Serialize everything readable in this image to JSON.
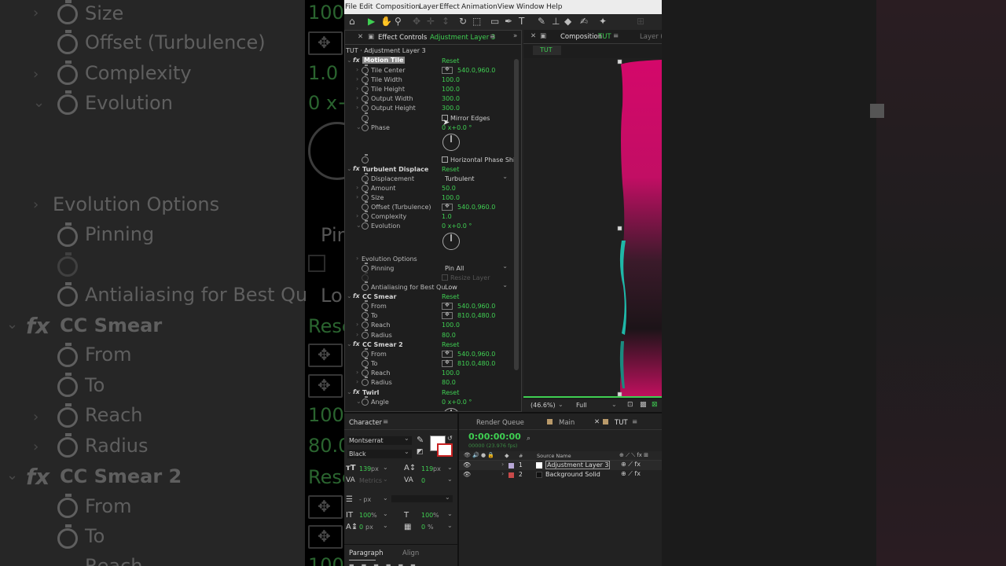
{
  "menu": [
    "File",
    "Edit",
    "Composition",
    "Layer",
    "Effect",
    "Animation",
    "View",
    "Window",
    "Help"
  ],
  "effect_panel": {
    "tab_label": "Effect Controls",
    "tab_layer": "Adjustment Layer 3",
    "breadcrumb": "TUT · Adjustment Layer 3",
    "reset": "Reset",
    "motion_tile": {
      "name": "Motion Tile",
      "tile_center": {
        "label": "Tile Center",
        "value": "540.0,960.0"
      },
      "tile_width": {
        "label": "Tile Width",
        "value": "100.0"
      },
      "tile_height": {
        "label": "Tile Height",
        "value": "100.0"
      },
      "output_width": {
        "label": "Output Width",
        "value": "300.0"
      },
      "output_height": {
        "label": "Output Height",
        "value": "300.0"
      },
      "mirror_edges": "Mirror Edges",
      "phase": {
        "label": "Phase",
        "value": "0 x+0.0 °"
      },
      "horizontal_phase": "Horizontal Phase Shi"
    },
    "turbulent_displace": {
      "name": "Turbulent Displace",
      "displacement": {
        "label": "Displacement",
        "value": "Turbulent"
      },
      "amount": {
        "label": "Amount",
        "value": "50.0"
      },
      "size": {
        "label": "Size",
        "value": "100.0"
      },
      "offset": {
        "label": "Offset (Turbulence)",
        "value": "540.0,960.0"
      },
      "complexity": {
        "label": "Complexity",
        "value": "1.0"
      },
      "evolution": {
        "label": "Evolution",
        "value": "0 x+0.0 °"
      },
      "evolution_options": "Evolution Options",
      "pinning": {
        "label": "Pinning",
        "value": "Pin All"
      },
      "resize_layer": "Resize Layer",
      "antialiasing": {
        "label": "Antialiasing for Best Qu",
        "value": "Low"
      }
    },
    "cc_smear": {
      "name": "CC Smear",
      "from": {
        "label": "From",
        "value": "540.0,960.0"
      },
      "to": {
        "label": "To",
        "value": "810.0,480.0"
      },
      "reach": {
        "label": "Reach",
        "value": "100.0"
      },
      "radius": {
        "label": "Radius",
        "value": "80.0"
      }
    },
    "cc_smear2": {
      "name": "CC Smear 2",
      "from": {
        "label": "From",
        "value": "540.0,960.0"
      },
      "to": {
        "label": "To",
        "value": "810.0,480.0"
      },
      "reach": {
        "label": "Reach",
        "value": "100.0"
      },
      "radius": {
        "label": "Radius",
        "value": "80.0"
      }
    },
    "twirl": {
      "name": "Twirl",
      "angle": {
        "label": "Angle",
        "value": "0 x+0.0 °"
      }
    }
  },
  "comp_panel": {
    "tab_label": "Composition",
    "tab_comp": "TUT",
    "layer_tab": "Layer",
    "layer_tab_rest": "(",
    "sub_tab": "TUT",
    "zoom": "(46.6%)",
    "quality": "Full"
  },
  "character_panel": {
    "title": "Character",
    "font": "Montserrat",
    "style": "Black",
    "size": "139",
    "size_unit": "px",
    "leading": "119",
    "leading_unit": "px",
    "kerning": "Metrics",
    "tracking": "0",
    "stroke_unit": "- px",
    "vscale": "100",
    "vscale_unit": "%",
    "hscale": "100",
    "hscale_unit": "%",
    "baseline": "0",
    "baseline_unit": "px",
    "tsume": "0",
    "tsume_unit": "%"
  },
  "paragraph_panel": {
    "tab1": "Paragraph",
    "tab2": "Align"
  },
  "timeline": {
    "tab_render": "Render Queue",
    "tab_main": "Main",
    "tab_tut": "TUT",
    "timecode": "0:00:00:00",
    "frames": "00000 (23.976 fps)",
    "col_num": "#",
    "col_source": "Source Name",
    "layers": [
      {
        "num": "1",
        "name": "Adjustment Layer 3",
        "color": "#b7a7d6"
      },
      {
        "num": "2",
        "name": "Background Solid",
        "color": "#c84a4a"
      }
    ]
  },
  "background_left": {
    "rows": [
      "Size",
      "Offset (Turbulence)",
      "Complexity",
      "Evolution",
      "Evolution Options",
      "Pinning",
      "Antialiasing for Best Qu",
      "CC Smear",
      "From",
      "To",
      "Reach",
      "Radius",
      "CC Smear 2",
      "From",
      "To",
      "Reach"
    ],
    "values": [
      "100.",
      "1.0",
      "0 x+",
      "Pin",
      "Lo",
      "Rese",
      "100.",
      "80.0",
      "Rese",
      "100."
    ]
  },
  "colors": {
    "accent": "#3fcf52",
    "viewer_pink": "#d4086a",
    "viewer_teal": "#1fb7a8"
  }
}
